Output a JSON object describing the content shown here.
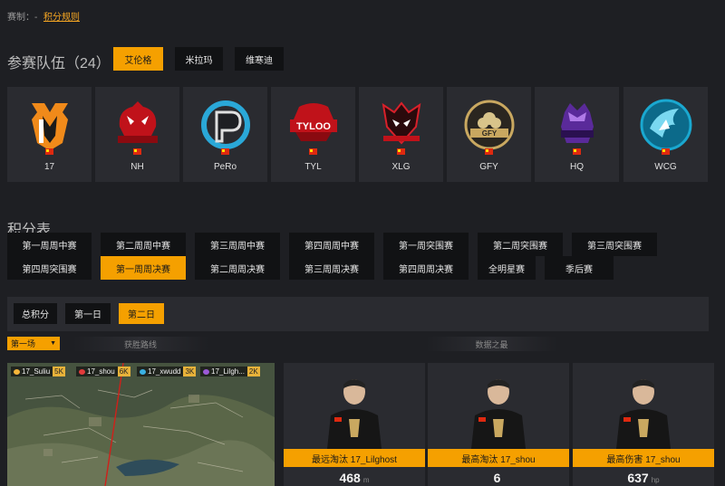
{
  "topbar": {
    "prefix": "赛制：-",
    "rules_link": "积分规则"
  },
  "teams_section": {
    "title": "参赛队伍（24）",
    "group_tabs": [
      "艾伦格",
      "米拉玛",
      "维寒迪"
    ],
    "active_group": "艾伦格",
    "teams": [
      {
        "name": "17"
      },
      {
        "name": "NH"
      },
      {
        "name": "PeRo"
      },
      {
        "name": "TYL"
      },
      {
        "name": "XLG"
      },
      {
        "name": "GFY"
      },
      {
        "name": "HQ"
      },
      {
        "name": "WCG"
      }
    ],
    "logo_text": {
      "TYL": "TYLOO",
      "GFY": "GFY"
    }
  },
  "points_section": {
    "title": "积分表",
    "stage_tabs_row1": [
      "第一周周中赛",
      "第二周周中赛",
      "第三周周中赛",
      "第四周周中赛",
      "第一周突围赛",
      "第二周突围赛",
      "第三周突围赛"
    ],
    "stage_tabs_row2": [
      "第四周突围赛",
      "第一周周决赛",
      "第二周周决赛",
      "第三周周决赛",
      "第四周周决赛",
      "全明星赛",
      "季后赛"
    ],
    "active_stage": "第一周周决赛",
    "day_tabs": [
      "总积分",
      "第一日",
      "第二日"
    ],
    "active_day": "第二日"
  },
  "match": {
    "round_select": "第一场",
    "route_title": "获胜路线",
    "data_title": "数据之最",
    "players": [
      {
        "name": "17_Suliu",
        "dist": "5K",
        "color": "#f5b53a"
      },
      {
        "name": "17_shou",
        "dist": "6K",
        "color": "#e23b3b"
      },
      {
        "name": "17_xwudd",
        "dist": "3K",
        "color": "#3ab0e2"
      },
      {
        "name": "17_Lilgh...",
        "dist": "2K",
        "color": "#9b59d6"
      }
    ],
    "stats": [
      {
        "label": "最远淘汰 17_Lilghost",
        "value": "468",
        "unit": "m"
      },
      {
        "label": "最高淘汰 17_shou",
        "value": "6",
        "unit": ""
      },
      {
        "label": "最高伤害 17_shou",
        "value": "637",
        "unit": "hp"
      }
    ]
  },
  "colors": {
    "accent": "#f5a000",
    "panel": "#2a2b30",
    "background": "#1e1f23"
  }
}
